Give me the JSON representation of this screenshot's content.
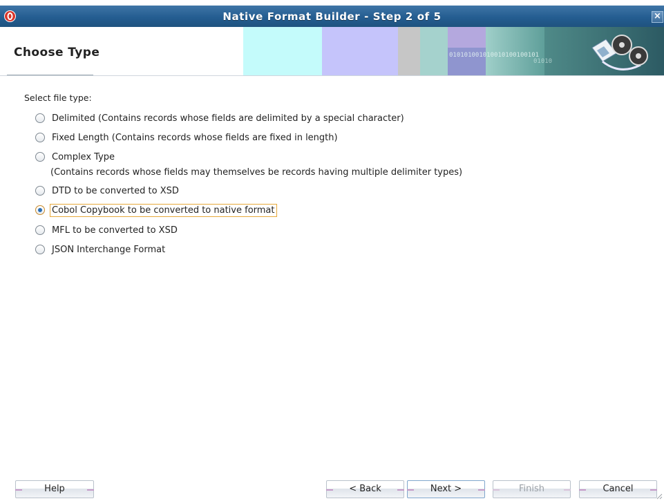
{
  "window": {
    "title": "Native Format Builder - Step 2 of 5",
    "close_label": "×"
  },
  "header": {
    "step_title": "Choose Type"
  },
  "content": {
    "section_label": "Select file type:",
    "options": [
      {
        "label": "Delimited (Contains records whose fields are delimited by a special character)",
        "checked": false
      },
      {
        "label": "Fixed Length (Contains records whose fields are fixed in length)",
        "checked": false
      },
      {
        "label": "Complex Type",
        "subtext": "(Contains records whose fields may themselves be records having multiple delimiter types)",
        "checked": false
      },
      {
        "label": "DTD to be converted to XSD",
        "checked": false
      },
      {
        "label": "Cobol Copybook to be converted to native format",
        "checked": true
      },
      {
        "label": "MFL to be converted to XSD",
        "checked": false
      },
      {
        "label": "JSON Interchange Format",
        "checked": false
      }
    ]
  },
  "buttons": {
    "help": "Help",
    "back": "< Back",
    "next": "Next >",
    "finish": "Finish",
    "cancel": "Cancel"
  },
  "colors": {
    "titlebar": "#245d91",
    "focus_outline": "#e7a83a",
    "radio_dot": "#2a6fb6"
  }
}
